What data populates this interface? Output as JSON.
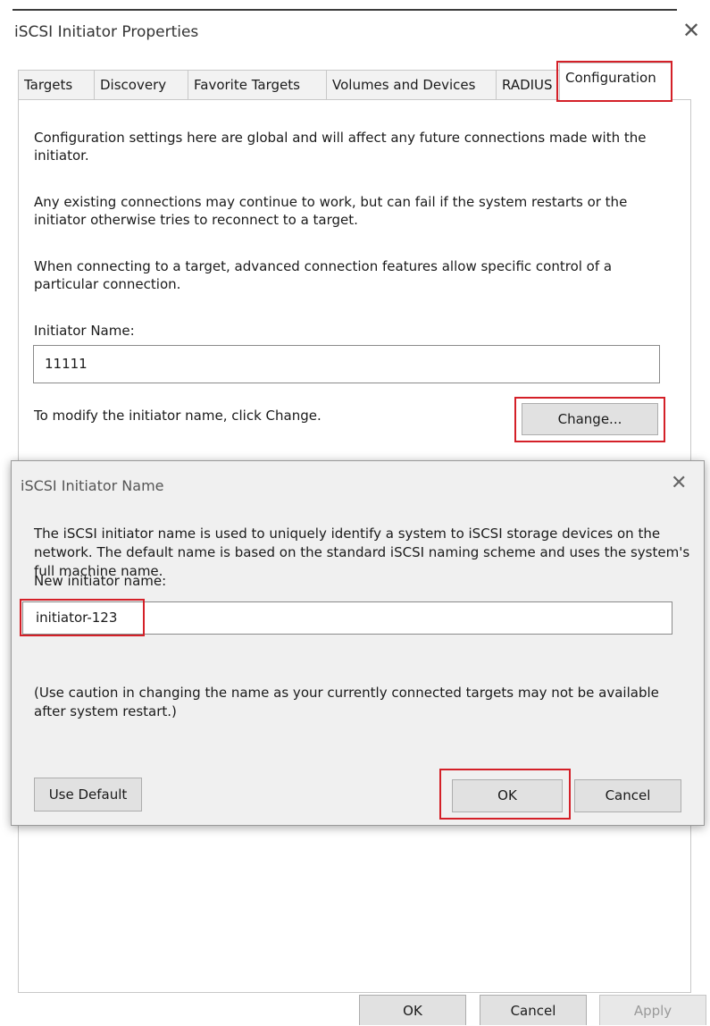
{
  "window": {
    "title": "iSCSI Initiator Properties",
    "close_glyph": "✕"
  },
  "tabs": [
    {
      "label": "Targets"
    },
    {
      "label": "Discovery"
    },
    {
      "label": "Favorite Targets"
    },
    {
      "label": "Volumes and Devices"
    },
    {
      "label": "RADIUS"
    },
    {
      "label": "Configuration",
      "active": true
    }
  ],
  "configuration": {
    "paragraph1": "Configuration settings here are global and will affect any future connections made with the initiator.",
    "paragraph2": "Any existing connections may continue to work, but can fail if the system restarts or the initiator otherwise tries to reconnect to a target.",
    "paragraph3": "When connecting to a target, advanced connection features allow specific control of a particular connection.",
    "initiator_name_label": "Initiator Name:",
    "initiator_name_value": "11111",
    "modify_hint": "To modify the initiator name, click Change.",
    "change_button": "Change..."
  },
  "dialog": {
    "title": "iSCSI Initiator Name",
    "close_glyph": "✕",
    "description": "The iSCSI initiator name is used to uniquely identify a system to iSCSI storage devices on the network.  The default name is based on the standard iSCSI naming scheme and uses the system's full machine name.",
    "new_name_label": "New initiator name:",
    "new_name_value": "initiator-123",
    "caution": "(Use caution in changing the name as your currently connected targets may not be available after system restart.)",
    "use_default_button": "Use Default",
    "ok_button": "OK",
    "cancel_button": "Cancel"
  },
  "footer": {
    "ok_button": "OK",
    "cancel_button": "Cancel",
    "apply_button": "Apply"
  },
  "highlight_color": "#d42028"
}
